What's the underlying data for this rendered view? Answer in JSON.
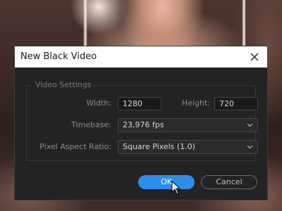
{
  "dialog": {
    "title": "New Black Video",
    "close_icon": "close-icon"
  },
  "video_settings": {
    "legend": "Video Settings",
    "width_label": "Width:",
    "width_value": "1280",
    "height_label": "Height:",
    "height_value": "720",
    "timebase_label": "Timebase:",
    "timebase_value": "23,976 fps",
    "par_label": "Pixel Aspect Ratio:",
    "par_value": "Square Pixels (1.0)"
  },
  "buttons": {
    "ok_label": "OK",
    "cancel_label": "Cancel"
  },
  "colors": {
    "accent": "#2d8ceb",
    "dialog_bg": "#232323",
    "titlebar_bg": "#ffffff"
  }
}
